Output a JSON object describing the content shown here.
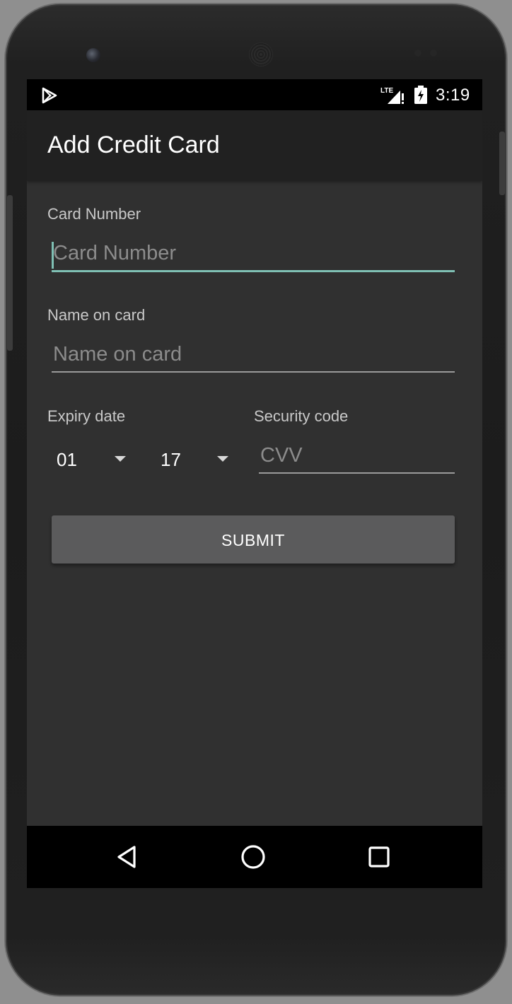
{
  "status_bar": {
    "time": "3:19",
    "icons": [
      "play-store-icon",
      "lte-signal-icon",
      "battery-charging-icon"
    ]
  },
  "app_bar": {
    "title": "Add Credit Card"
  },
  "form": {
    "card_number": {
      "label": "Card Number",
      "placeholder": "Card Number",
      "value": ""
    },
    "name_on_card": {
      "label": "Name on card",
      "placeholder": "Name on card",
      "value": ""
    },
    "expiry": {
      "label": "Expiry date",
      "month": "01",
      "year": "17"
    },
    "security_code": {
      "label": "Security code",
      "placeholder": "CVV",
      "value": ""
    },
    "submit_label": "SUBMIT"
  },
  "nav_bar": {
    "buttons": [
      "back-icon",
      "home-icon",
      "recents-icon"
    ]
  },
  "colors": {
    "accent": "#7fc0b4",
    "background": "#303030",
    "app_bar": "#212121",
    "button": "#5b5b5c"
  }
}
